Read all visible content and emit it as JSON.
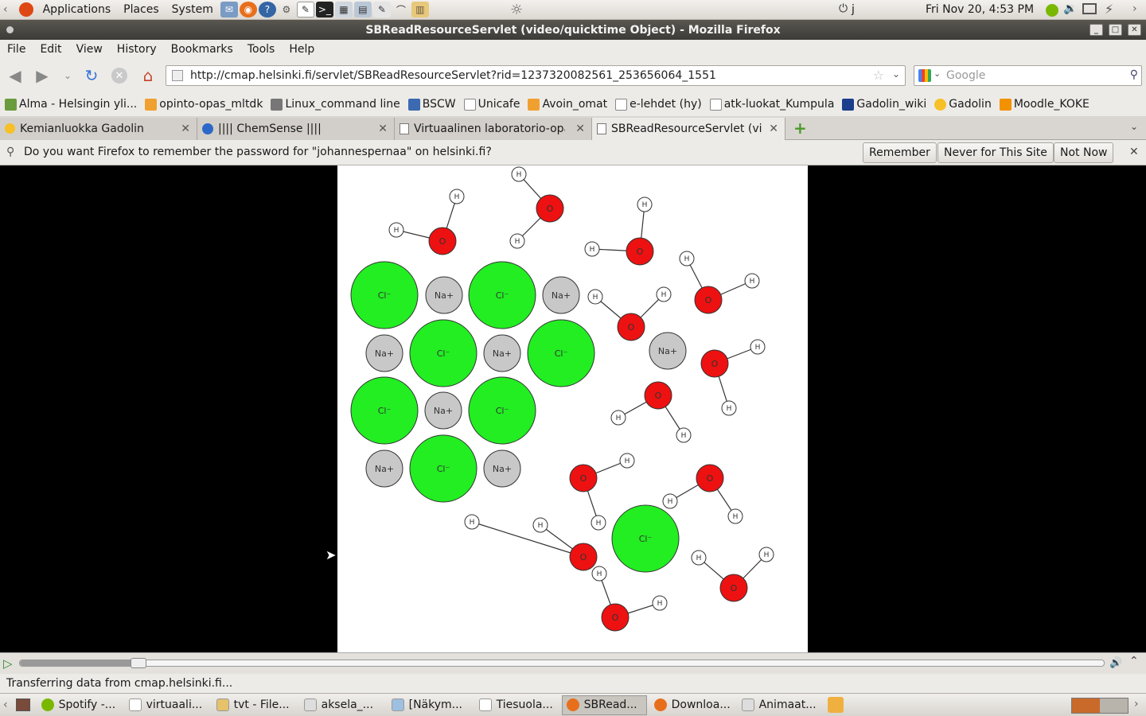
{
  "panel": {
    "apps": "Applications",
    "places": "Places",
    "system": "System",
    "user": "j",
    "clock": "Fri Nov 20,  4:53 PM"
  },
  "window": {
    "title": "SBReadResourceServlet (video/quicktime Object) - Mozilla Firefox"
  },
  "menu": {
    "file": "File",
    "edit": "Edit",
    "view": "View",
    "history": "History",
    "bookmarks": "Bookmarks",
    "tools": "Tools",
    "help": "Help"
  },
  "nav": {
    "url": "http://cmap.helsinki.fi/servlet/SBReadResourceServlet?rid=1237320082561_253656064_1551",
    "search_placeholder": "Google"
  },
  "bookmarks": [
    "Alma - Helsingin yli...",
    "opinto-opas_mltdk",
    "Linux_command line",
    "BSCW",
    "Unicafe",
    "Avoin_omat",
    "e-lehdet (hy)",
    "atk-luokat_Kumpula",
    "Gadolin_wiki",
    "Gadolin",
    "Moodle_KOKE"
  ],
  "tabs": [
    "Kemianluokka Gadolin",
    "|||| ChemSense ||||",
    "Virtuaalinen laboratorio-opas",
    "SBReadResourceServlet (vi..."
  ],
  "notify": {
    "text": "Do you want Firefox to remember the password for \"johannespernaa\" on helsinki.fi?",
    "remember": "Remember",
    "never": "Never for This Site",
    "not_now": "Not Now"
  },
  "molecules": {
    "cl": "Cl⁻",
    "na": "Na+",
    "o": "O",
    "h": "H"
  },
  "video": {
    "progress": 0.1
  },
  "status": "Transferring data from cmap.helsinki.fi...",
  "taskbar": [
    "Spotify -...",
    "virtuaali...",
    "tvt - File...",
    "aksela_...",
    "[Näkym...",
    "Tiesuola...",
    "SBRead...",
    "Downloa...",
    "Animaat..."
  ]
}
